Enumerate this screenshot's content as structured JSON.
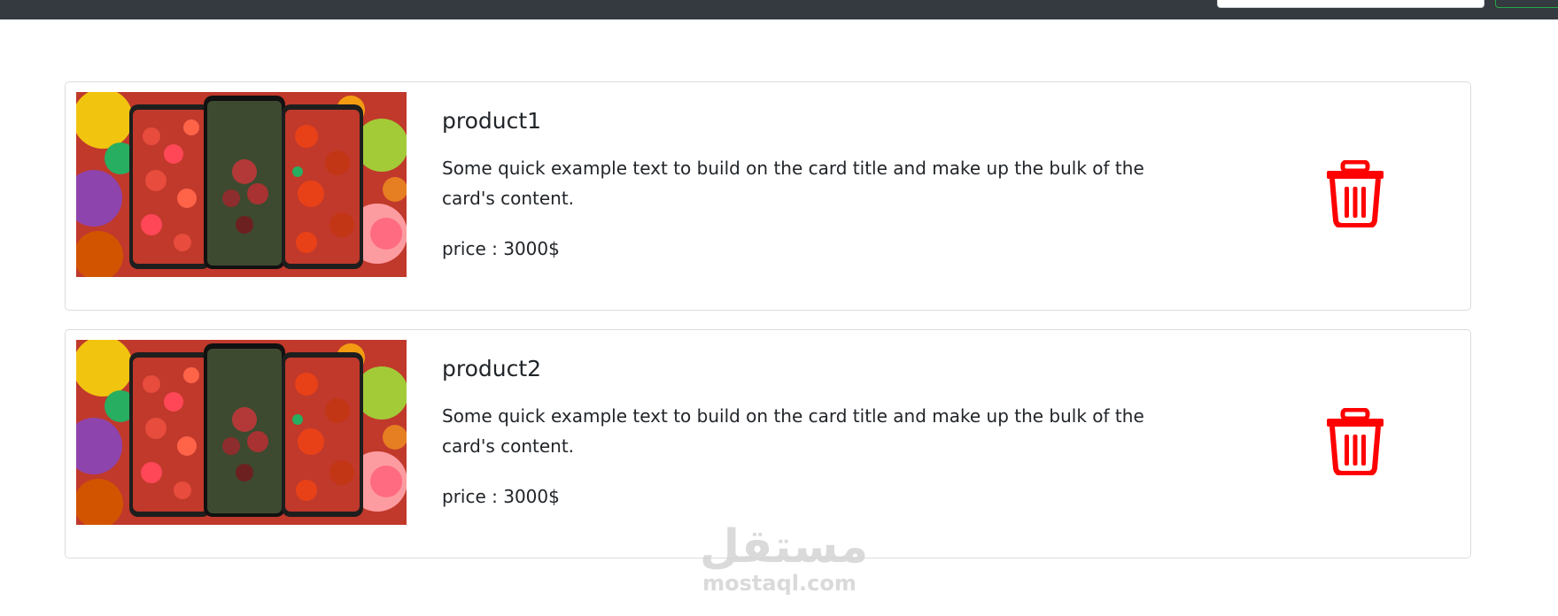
{
  "products": [
    {
      "title": "product1",
      "description": "Some quick example text to build on the card title and make up the bulk of the card's content.",
      "price": "price : 3000$",
      "delete_icon": "trash-icon"
    },
    {
      "title": "product2",
      "description": "Some quick example text to build on the card title and make up the bulk of the card's content.",
      "price": "price : 3000$",
      "delete_icon": "trash-icon"
    }
  ],
  "watermark": {
    "arabic": "مستقل",
    "latin": "mostaql.com"
  },
  "colors": {
    "navbar": "#343a40",
    "delete": "#ff0000",
    "card_border": "#dcdcdc",
    "text": "#212529"
  }
}
